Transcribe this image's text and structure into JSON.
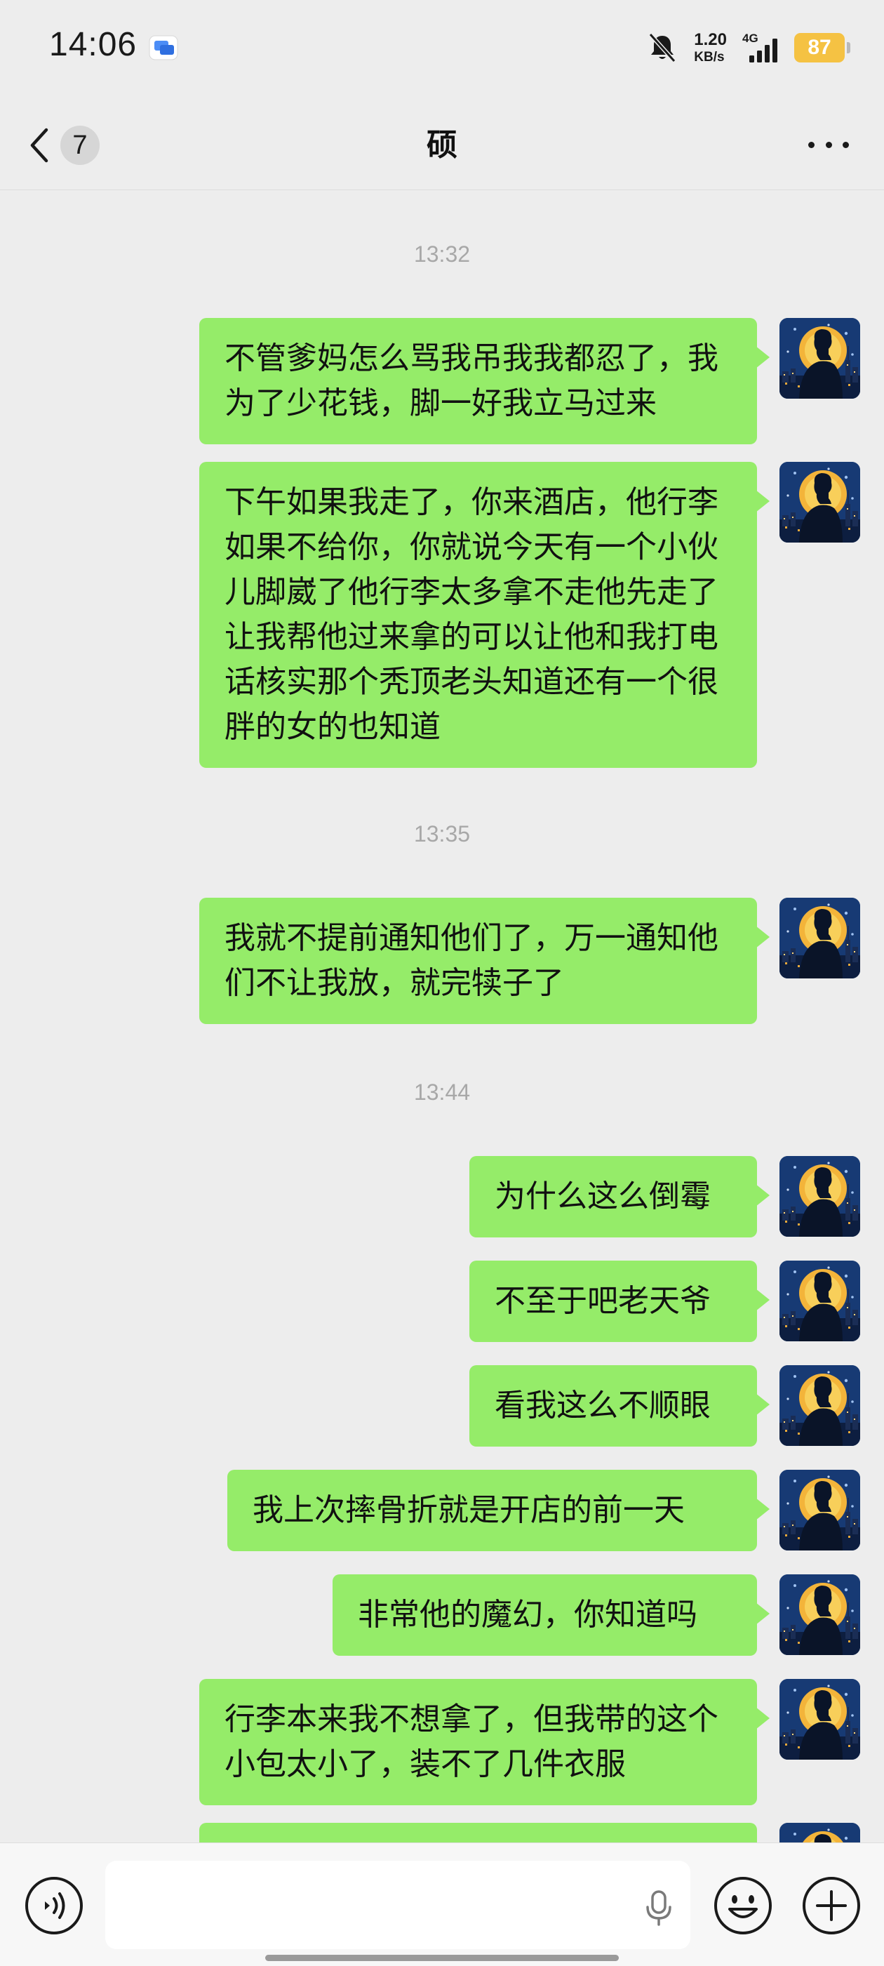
{
  "status_bar": {
    "time": "14:06",
    "network_speed_value": "1.20",
    "network_speed_unit": "KB/s",
    "network_type": "4G",
    "battery": "87"
  },
  "header": {
    "back_unread_count": "7",
    "title": "硕"
  },
  "timestamps": [
    "13:32",
    "13:35",
    "13:44"
  ],
  "messages": [
    {
      "sender": "self",
      "text": "不管爹妈怎么骂我吊我我都忍了，我为了少花钱，脚一好我立马过来"
    },
    {
      "sender": "self",
      "text": "下午如果我走了，你来酒店，他行李如果不给你，你就说今天有一个小伙儿脚崴了他行李太多拿不走他先走了让我帮他过来拿的可以让他和我打电话核实那个秃顶老头知道还有一个很胖的女的也知道"
    },
    {
      "sender": "self",
      "text": "我就不提前通知他们了，万一通知他们不让我放，就完犊子了"
    },
    {
      "sender": "self",
      "text": "为什么这么倒霉"
    },
    {
      "sender": "self",
      "text": "不至于吧老天爷"
    },
    {
      "sender": "self",
      "text": "看我这么不顺眼"
    },
    {
      "sender": "self",
      "text": "我上次摔骨折就是开店的前一天"
    },
    {
      "sender": "self",
      "text": "非常他的魔幻，你知道吗"
    },
    {
      "sender": "self",
      "text": "行李本来我不想拿了，但我带的这个小包太小了，装不了几件衣服"
    },
    {
      "sender": "self",
      "text": ""
    }
  ],
  "input": {
    "value": "",
    "placeholder": ""
  },
  "colors": {
    "background": "#EDEDED",
    "bubble_self": "#95EC69",
    "battery": "#F5C243",
    "timestamp": "#A8A8A8"
  },
  "icons": {
    "back": "chevron-left-icon",
    "more": "more-dots-icon",
    "mute": "bell-muted-icon",
    "voice": "voice-icon",
    "mic": "microphone-icon",
    "emoji": "emoji-icon",
    "plus": "plus-circle-icon"
  }
}
